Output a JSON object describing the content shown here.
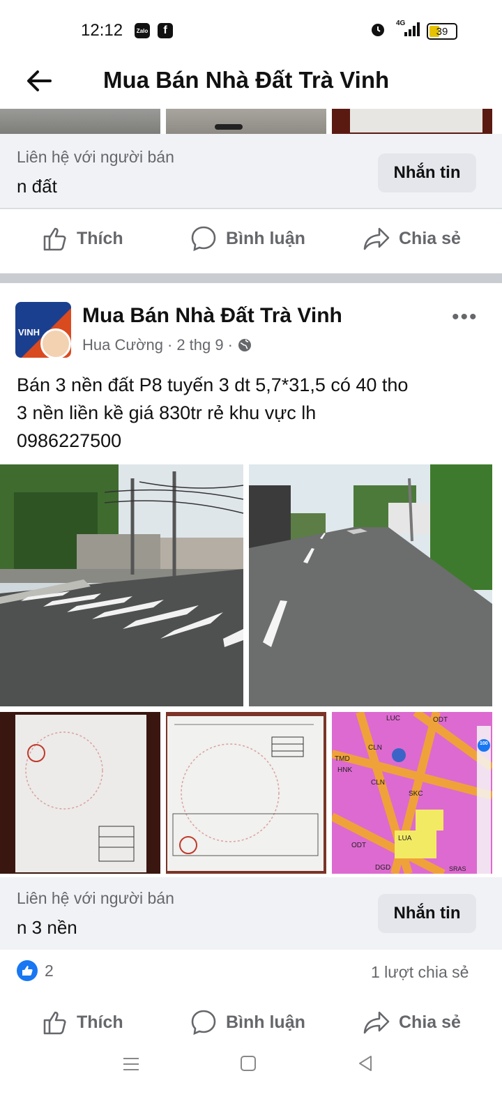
{
  "status_bar": {
    "time": "12:12",
    "app1": "Zalo",
    "app2": "f",
    "network": "4G",
    "battery": "39"
  },
  "header": {
    "title": "Mua Bán Nhà Đất Trà Vinh"
  },
  "prev_post": {
    "contact_label": "Liên hệ với người bán",
    "contact_value": "n đất",
    "message_button": "Nhắn tin",
    "actions": {
      "like": "Thích",
      "comment": "Bình luận",
      "share": "Chia sẻ"
    }
  },
  "post": {
    "group_name": "Mua Bán Nhà Đất Trà Vinh",
    "author": "Hua Cường",
    "date": "2 thg 9",
    "avatar_text": "VINH",
    "body_line1": "Bán 3 nền đất P8 tuyến 3 dt 5,7*31,5 có 40 tho",
    "body_line2": "3 nền liền kề giá 830tr rẻ khu vực lh",
    "body_line3": "0986227500",
    "contact_label": "Liên hệ với người bán",
    "contact_value": "n 3 nền",
    "message_button": "Nhắn tin",
    "reaction_count": "2",
    "share_count": "1 lượt chia sẻ",
    "actions": {
      "like": "Thích",
      "comment": "Bình luận",
      "share": "Chia sẻ"
    },
    "map_labels": [
      "LUC",
      "ODT",
      "CLN",
      "TMD",
      "HNK",
      "SKC",
      "LUA",
      "DGD",
      "ODT",
      "CLN",
      "SRAS",
      "100"
    ]
  },
  "nav_bar": {
    "icons": [
      "menu-icon",
      "home-square-icon",
      "back-triangle-icon"
    ]
  },
  "colors": {
    "accent": "#1877f2",
    "contact_bg": "#f0f2f5",
    "button_bg": "#e4e6eb",
    "secondary_text": "#65676b",
    "divider": "#c9ccd1"
  }
}
